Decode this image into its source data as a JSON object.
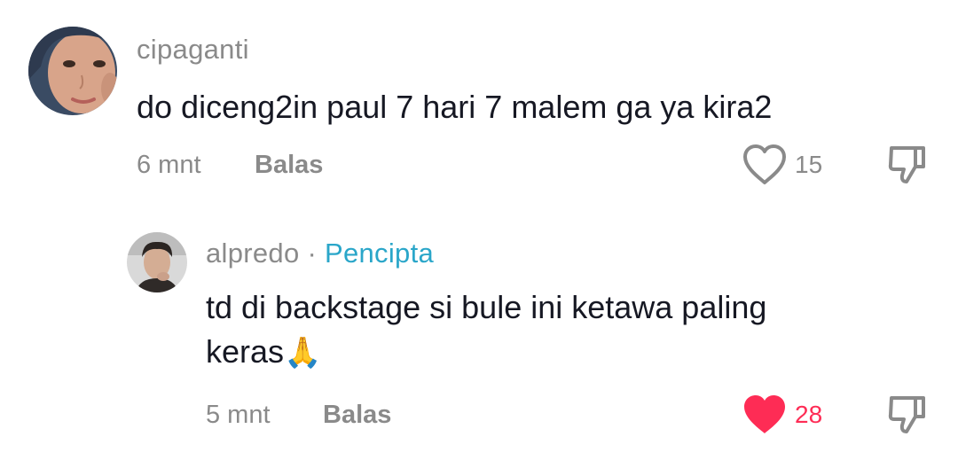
{
  "comments": [
    {
      "username": "cipaganti",
      "text": "do diceng2in paul 7 hari 7 malem ga ya kira2",
      "time": "6 mnt",
      "reply_label": "Balas",
      "likes": "15",
      "liked": false
    }
  ],
  "reply": {
    "username": "alpredo",
    "separator": "·",
    "badge": "Pencipta",
    "text_line1": "td di backstage si bule ini ketawa paling",
    "text_line2": "keras",
    "emoji": "🙏",
    "time": "5 mnt",
    "reply_label": "Balas",
    "likes": "28",
    "liked": true
  },
  "colors": {
    "liked": "#fe2c55",
    "badge": "#2aa6c9",
    "muted": "#8a8a8a",
    "text": "#161823"
  },
  "icons": {
    "like": "heart-icon",
    "dislike": "thumbs-down-icon"
  }
}
